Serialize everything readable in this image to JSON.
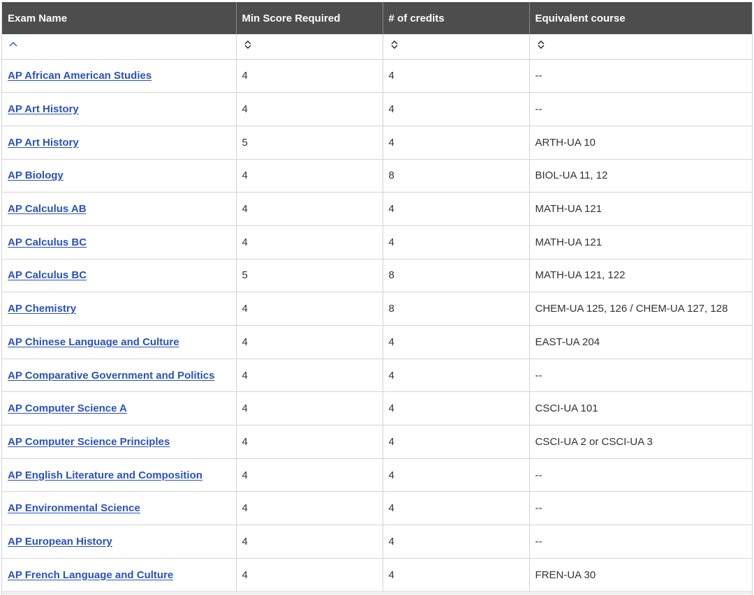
{
  "table": {
    "columns": [
      {
        "label": "Exam Name",
        "sort_icon": "chevron-up-icon"
      },
      {
        "label": "Min Score Required",
        "sort_icon": "sort-toggle-icon"
      },
      {
        "label": "# of credits",
        "sort_icon": "sort-toggle-icon"
      },
      {
        "label": "Equivalent course",
        "sort_icon": "sort-toggle-icon"
      }
    ],
    "rows": [
      {
        "exam": "AP African American Studies",
        "min_score": "4",
        "credits": "4",
        "equivalent": "--"
      },
      {
        "exam": "AP Art History",
        "min_score": "4",
        "credits": "4",
        "equivalent": "--"
      },
      {
        "exam": "AP Art History",
        "min_score": "5",
        "credits": "4",
        "equivalent": "ARTH-UA 10"
      },
      {
        "exam": "AP Biology",
        "min_score": "4",
        "credits": "8",
        "equivalent": "BIOL-UA 11, 12"
      },
      {
        "exam": "AP Calculus AB",
        "min_score": "4",
        "credits": "4",
        "equivalent": "MATH-UA 121"
      },
      {
        "exam": "AP Calculus BC",
        "min_score": "4",
        "credits": "4",
        "equivalent": "MATH-UA 121"
      },
      {
        "exam": "AP Calculus BC",
        "min_score": "5",
        "credits": "8",
        "equivalent": "MATH-UA 121, 122"
      },
      {
        "exam": "AP Chemistry",
        "min_score": "4",
        "credits": "8",
        "equivalent": "CHEM-UA 125, 126 / CHEM-UA 127, 128"
      },
      {
        "exam": "AP Chinese Language and Culture",
        "min_score": "4",
        "credits": "4",
        "equivalent": "EAST-UA 204"
      },
      {
        "exam": "AP Comparative Government and Politics",
        "min_score": "4",
        "credits": "4",
        "equivalent": "--"
      },
      {
        "exam": "AP Computer Science A",
        "min_score": "4",
        "credits": "4",
        "equivalent": "CSCI-UA 101"
      },
      {
        "exam": "AP Computer Science Principles",
        "min_score": "4",
        "credits": "4",
        "equivalent": "CSCI-UA 2 or CSCI-UA 3"
      },
      {
        "exam": "AP English Literature and Composition",
        "min_score": "4",
        "credits": "4",
        "equivalent": "--"
      },
      {
        "exam": "AP Environmental Science",
        "min_score": "4",
        "credits": "4",
        "equivalent": "--"
      },
      {
        "exam": "AP European History",
        "min_score": "4",
        "credits": "4",
        "equivalent": "--"
      },
      {
        "exam": "AP French Language and Culture",
        "min_score": "4",
        "credits": "4",
        "equivalent": "FREN-UA 30"
      }
    ]
  },
  "colors": {
    "header_bg": "#4d4d4d",
    "link": "#2a52be",
    "border": "#d4d4d4"
  }
}
